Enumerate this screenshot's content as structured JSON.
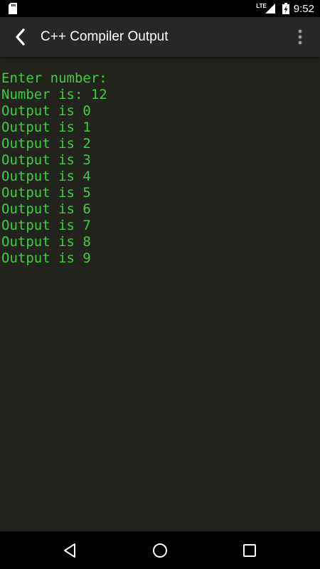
{
  "status_bar": {
    "time": "9:52",
    "network": "LTE",
    "icons": [
      "sd-card-icon",
      "signal-icon",
      "battery-charging-icon"
    ]
  },
  "app_bar": {
    "title": "C++ Compiler Output",
    "icons": [
      "back-arrow-icon",
      "overflow-menu-icon"
    ]
  },
  "console": {
    "lines": [
      "Enter number:",
      "Number is: 12",
      "Output is 0",
      "Output is 1",
      "Output is 2",
      "Output is 3",
      "Output is 4",
      "Output is 5",
      "Output is 6",
      "Output is 7",
      "Output is 8",
      "Output is 9"
    ],
    "text_color": "#3fcc3f",
    "background_color": "#23231e"
  },
  "nav_bar": {
    "icons": [
      "back-triangle-icon",
      "home-circle-icon",
      "recents-square-icon"
    ]
  }
}
